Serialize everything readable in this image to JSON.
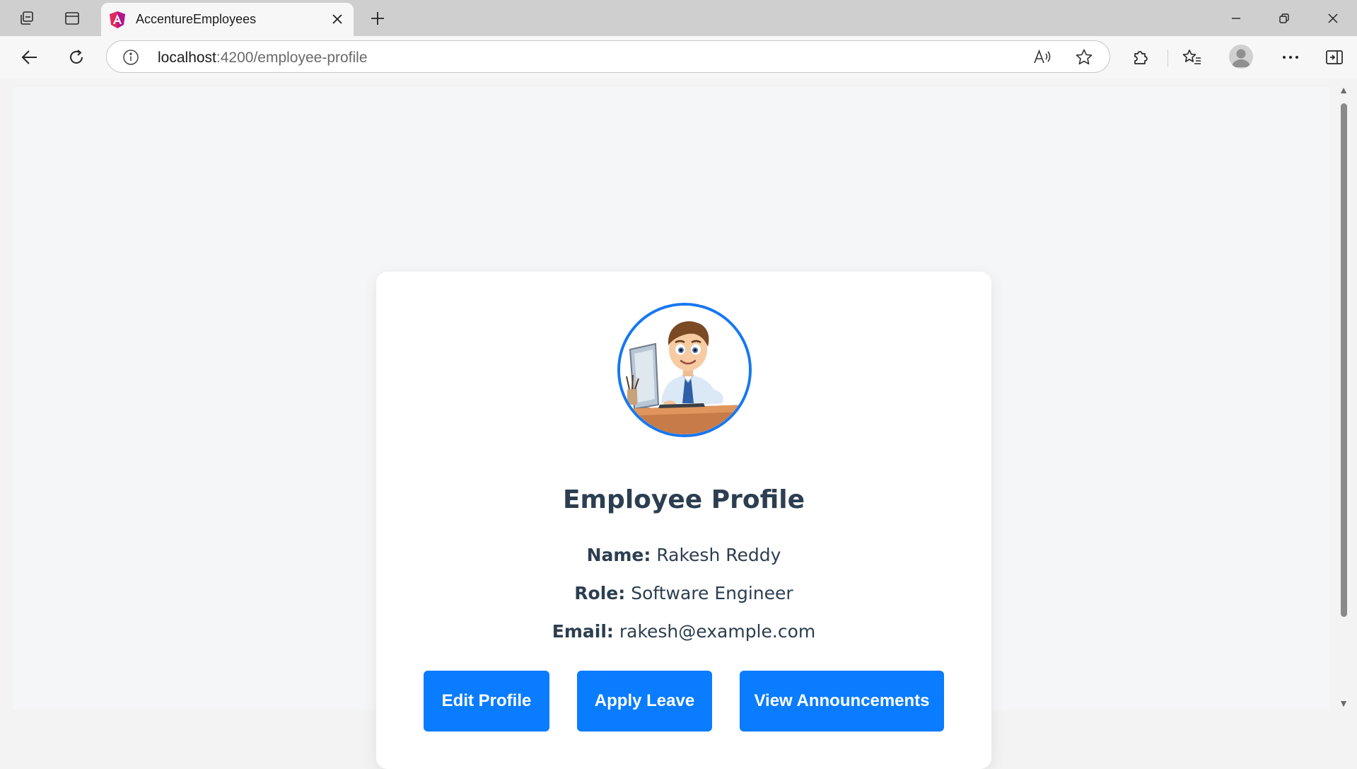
{
  "browser": {
    "tab_title": "AccentureEmployees",
    "url_host": "localhost",
    "url_path": ":4200/employee-profile",
    "icons": {
      "workspaces": "workspaces-icon",
      "tab_actions": "tab-actions-icon",
      "close": "close-icon",
      "new_tab": "plus-icon",
      "back": "back-arrow-icon",
      "refresh": "refresh-icon",
      "site_info": "info-icon",
      "read_aloud": "read-aloud-icon",
      "favorite": "star-icon",
      "extensions": "puzzle-icon",
      "favorites": "favorites-icon",
      "profile": "profile-avatar-icon",
      "more": "more-icon",
      "sidebar": "sidebar-icon"
    }
  },
  "profile": {
    "title": "Employee Profile",
    "name_label": "Name:",
    "name_value": "Rakesh Reddy",
    "role_label": "Role:",
    "role_value": "Software Engineer",
    "email_label": "Email:",
    "email_value": "rakesh@example.com",
    "avatar": "employee-cartoon-avatar"
  },
  "actions": {
    "edit_profile": "Edit Profile",
    "apply_leave": "Apply Leave",
    "view_announcements": "View Announcements"
  },
  "colors": {
    "accent": "#0a7cff",
    "avatar_border": "#1677f2",
    "text": "#2c3e50",
    "page_bg": "#f5f6f8"
  }
}
